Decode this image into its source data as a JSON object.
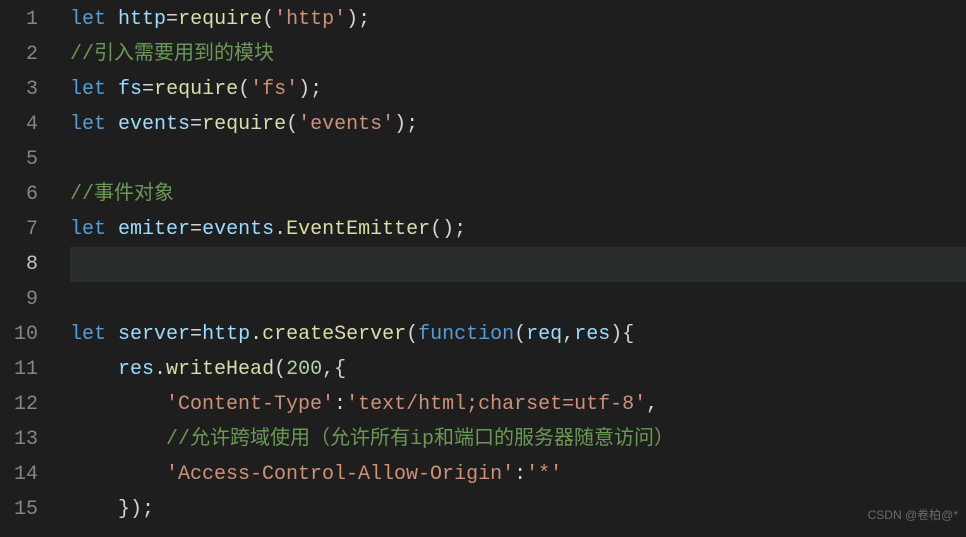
{
  "lines": [
    {
      "num": "1"
    },
    {
      "num": "2"
    },
    {
      "num": "3"
    },
    {
      "num": "4"
    },
    {
      "num": "5"
    },
    {
      "num": "6"
    },
    {
      "num": "7"
    },
    {
      "num": "8"
    },
    {
      "num": "9"
    },
    {
      "num": "10"
    },
    {
      "num": "11"
    },
    {
      "num": "12"
    },
    {
      "num": "13"
    },
    {
      "num": "14"
    },
    {
      "num": "15"
    }
  ],
  "tokens": {
    "let": "let",
    "http": "http",
    "eq": "=",
    "require": "require",
    "lparen": "(",
    "rparen": ")",
    "lbrace": "{",
    "rbrace": "}",
    "semi": ";",
    "comma": ",",
    "dot": ".",
    "colon": ":",
    "str_http": "'http'",
    "comment1": "//引入需要用到的模块",
    "fs": "fs",
    "str_fs": "'fs'",
    "events": "events",
    "str_events": "'events'",
    "comment2": "//事件对象",
    "emiter": "emiter",
    "EventEmitter": "EventEmitter",
    "server": "server",
    "createServer": "createServer",
    "function": "function",
    "req": "req",
    "res": "res",
    "writeHead": "writeHead",
    "n200": "200",
    "str_ctype": "'Content-Type'",
    "str_html": "'text/html;charset=utf-8'",
    "comment3": "//允许跨域使用（允许所有ip和端口的服务器随意访问）",
    "str_acao": "'Access-Control-Allow-Origin'",
    "str_star": "'*'"
  },
  "watermark": "CSDN @卷柏@*"
}
